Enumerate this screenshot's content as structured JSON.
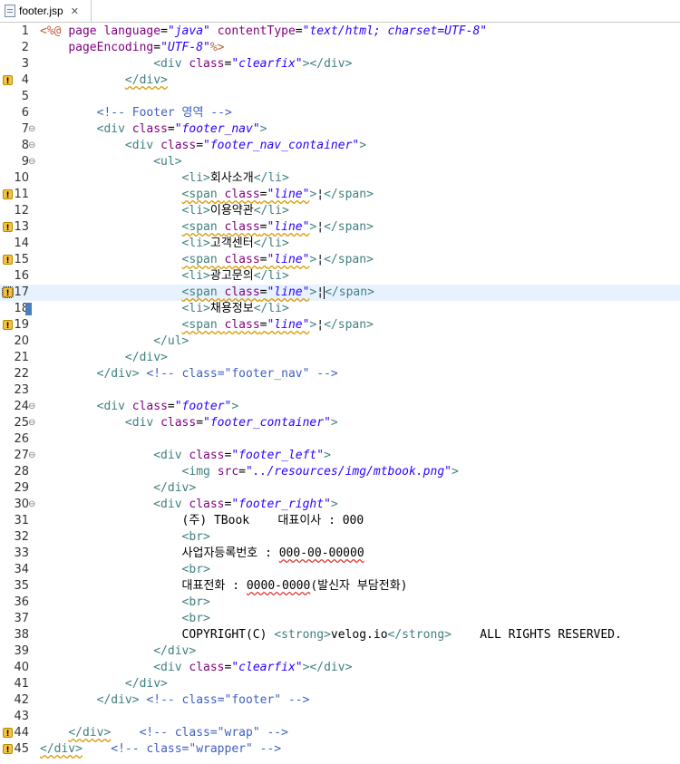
{
  "tab": {
    "filename": "footer.jsp",
    "close_glyph": "✕"
  },
  "colors": {
    "tag": "#3f7f7f",
    "attribute": "#7f007f",
    "value": "#2a00ff",
    "comment": "#3f5fbf",
    "jsp_delimiter": "#bf5f3f",
    "current_line": "#e8f2fe"
  },
  "lines": [
    {
      "n": "1",
      "warn": false,
      "fold": "",
      "tokens": [
        {
          "t": "jsp",
          "s": "<%@ "
        },
        {
          "t": "attr",
          "s": "page "
        },
        {
          "t": "attr",
          "s": "language"
        },
        {
          "t": "txt",
          "s": "="
        },
        {
          "t": "val",
          "s": "\"java\""
        },
        {
          "t": "txt",
          "s": " "
        },
        {
          "t": "attr",
          "s": "contentType"
        },
        {
          "t": "txt",
          "s": "="
        },
        {
          "t": "val",
          "s": "\"text/html; charset=UTF-8\""
        }
      ]
    },
    {
      "n": "2",
      "warn": false,
      "fold": "",
      "tokens": [
        {
          "t": "txt",
          "s": "    "
        },
        {
          "t": "attr",
          "s": "pageEncoding"
        },
        {
          "t": "txt",
          "s": "="
        },
        {
          "t": "val",
          "s": "\"UTF-8\""
        },
        {
          "t": "jsp",
          "s": "%>"
        }
      ]
    },
    {
      "n": "3",
      "warn": false,
      "fold": "",
      "tokens": [
        {
          "t": "txt",
          "s": "                "
        },
        {
          "t": "tag",
          "s": "<div "
        },
        {
          "t": "attr",
          "s": "class"
        },
        {
          "t": "txt",
          "s": "="
        },
        {
          "t": "val",
          "s": "\"clearfix\""
        },
        {
          "t": "tag",
          "s": "></div>"
        }
      ]
    },
    {
      "n": "4",
      "warn": true,
      "fold": "",
      "tokens": [
        {
          "t": "txt",
          "s": "            "
        },
        {
          "t": "tag sq",
          "s": "</div>"
        }
      ]
    },
    {
      "n": "5",
      "warn": false,
      "fold": "",
      "tokens": []
    },
    {
      "n": "6",
      "warn": false,
      "fold": "",
      "tokens": [
        {
          "t": "txt",
          "s": "        "
        },
        {
          "t": "cmt",
          "s": "<!-- Footer 영역 -->"
        }
      ]
    },
    {
      "n": "7",
      "warn": false,
      "fold": "⊖",
      "tokens": [
        {
          "t": "txt",
          "s": "        "
        },
        {
          "t": "tag",
          "s": "<div "
        },
        {
          "t": "attr",
          "s": "class"
        },
        {
          "t": "txt",
          "s": "="
        },
        {
          "t": "val",
          "s": "\"footer_nav\""
        },
        {
          "t": "tag",
          "s": ">"
        }
      ]
    },
    {
      "n": "8",
      "warn": false,
      "fold": "⊖",
      "tokens": [
        {
          "t": "txt",
          "s": "            "
        },
        {
          "t": "tag",
          "s": "<div "
        },
        {
          "t": "attr",
          "s": "class"
        },
        {
          "t": "txt",
          "s": "="
        },
        {
          "t": "val",
          "s": "\"footer_nav_container\""
        },
        {
          "t": "tag",
          "s": ">"
        }
      ]
    },
    {
      "n": "9",
      "warn": false,
      "fold": "⊖",
      "tokens": [
        {
          "t": "txt",
          "s": "                "
        },
        {
          "t": "tag",
          "s": "<ul>"
        }
      ]
    },
    {
      "n": "10",
      "warn": false,
      "fold": "",
      "tokens": [
        {
          "t": "txt",
          "s": "                    "
        },
        {
          "t": "tag",
          "s": "<li>"
        },
        {
          "t": "txt",
          "s": "회사소개"
        },
        {
          "t": "tag",
          "s": "</li>"
        }
      ]
    },
    {
      "n": "11",
      "warn": true,
      "fold": "",
      "tokens": [
        {
          "t": "txt",
          "s": "                    "
        },
        {
          "t": "tag sq",
          "s": "<span "
        },
        {
          "t": "attr sq",
          "s": "class"
        },
        {
          "t": "txt sq",
          "s": "="
        },
        {
          "t": "val sq",
          "s": "\"line\""
        },
        {
          "t": "tag",
          "s": ">"
        },
        {
          "t": "txt",
          "s": "¦"
        },
        {
          "t": "tag",
          "s": "</span>"
        }
      ]
    },
    {
      "n": "12",
      "warn": false,
      "fold": "",
      "tokens": [
        {
          "t": "txt",
          "s": "                    "
        },
        {
          "t": "tag",
          "s": "<li>"
        },
        {
          "t": "txt",
          "s": "이용약관"
        },
        {
          "t": "tag",
          "s": "</li>"
        }
      ]
    },
    {
      "n": "13",
      "warn": true,
      "fold": "",
      "tokens": [
        {
          "t": "txt",
          "s": "                    "
        },
        {
          "t": "tag sq",
          "s": "<span "
        },
        {
          "t": "attr sq",
          "s": "class"
        },
        {
          "t": "txt sq",
          "s": "="
        },
        {
          "t": "val sq",
          "s": "\"line\""
        },
        {
          "t": "tag",
          "s": ">"
        },
        {
          "t": "txt",
          "s": "¦"
        },
        {
          "t": "tag",
          "s": "</span>"
        }
      ]
    },
    {
      "n": "14",
      "warn": false,
      "fold": "",
      "tokens": [
        {
          "t": "txt",
          "s": "                    "
        },
        {
          "t": "tag",
          "s": "<li>"
        },
        {
          "t": "txt",
          "s": "고객센터"
        },
        {
          "t": "tag",
          "s": "</li>"
        }
      ]
    },
    {
      "n": "15",
      "warn": true,
      "fold": "",
      "tokens": [
        {
          "t": "txt",
          "s": "                    "
        },
        {
          "t": "tag sq",
          "s": "<span "
        },
        {
          "t": "attr sq",
          "s": "class"
        },
        {
          "t": "txt sq",
          "s": "="
        },
        {
          "t": "val sq",
          "s": "\"line\""
        },
        {
          "t": "tag",
          "s": ">"
        },
        {
          "t": "txt",
          "s": "¦"
        },
        {
          "t": "tag",
          "s": "</span>"
        }
      ]
    },
    {
      "n": "16",
      "warn": false,
      "fold": "",
      "tokens": [
        {
          "t": "txt",
          "s": "                    "
        },
        {
          "t": "tag",
          "s": "<li>"
        },
        {
          "t": "txt",
          "s": "광고문의"
        },
        {
          "t": "tag",
          "s": "</li>"
        }
      ]
    },
    {
      "n": "17",
      "warn": true,
      "fold": "",
      "current": true,
      "sel": true,
      "tokens": [
        {
          "t": "txt",
          "s": "                    "
        },
        {
          "t": "tag sq",
          "s": "<span "
        },
        {
          "t": "attr sq",
          "s": "class"
        },
        {
          "t": "txt sq",
          "s": "="
        },
        {
          "t": "val sq",
          "s": "\"line\""
        },
        {
          "t": "tag",
          "s": ">"
        },
        {
          "t": "txt",
          "s": "¦"
        },
        {
          "t": "caret",
          "s": ""
        },
        {
          "t": "tag",
          "s": "</span>"
        }
      ]
    },
    {
      "n": "18",
      "warn": false,
      "fold": "",
      "bookmark": true,
      "tokens": [
        {
          "t": "txt",
          "s": "                    "
        },
        {
          "t": "tag",
          "s": "<li>"
        },
        {
          "t": "txt",
          "s": "채용정보"
        },
        {
          "t": "tag",
          "s": "</li>"
        }
      ]
    },
    {
      "n": "19",
      "warn": true,
      "fold": "",
      "tokens": [
        {
          "t": "txt",
          "s": "                    "
        },
        {
          "t": "tag sq",
          "s": "<span "
        },
        {
          "t": "attr sq",
          "s": "class"
        },
        {
          "t": "txt sq",
          "s": "="
        },
        {
          "t": "val sq",
          "s": "\"line\""
        },
        {
          "t": "tag",
          "s": ">"
        },
        {
          "t": "txt",
          "s": "¦"
        },
        {
          "t": "tag",
          "s": "</span>"
        }
      ]
    },
    {
      "n": "20",
      "warn": false,
      "fold": "",
      "tokens": [
        {
          "t": "txt",
          "s": "                "
        },
        {
          "t": "tag",
          "s": "</ul>"
        }
      ]
    },
    {
      "n": "21",
      "warn": false,
      "fold": "",
      "tokens": [
        {
          "t": "txt",
          "s": "            "
        },
        {
          "t": "tag",
          "s": "</div>"
        }
      ]
    },
    {
      "n": "22",
      "warn": false,
      "fold": "",
      "tokens": [
        {
          "t": "txt",
          "s": "        "
        },
        {
          "t": "tag",
          "s": "</div>"
        },
        {
          "t": "txt",
          "s": " "
        },
        {
          "t": "cmt",
          "s": "<!-- class=\"footer_nav\" -->"
        }
      ]
    },
    {
      "n": "23",
      "warn": false,
      "fold": "",
      "tokens": []
    },
    {
      "n": "24",
      "warn": false,
      "fold": "⊖",
      "tokens": [
        {
          "t": "txt",
          "s": "        "
        },
        {
          "t": "tag",
          "s": "<div "
        },
        {
          "t": "attr",
          "s": "class"
        },
        {
          "t": "txt",
          "s": "="
        },
        {
          "t": "val",
          "s": "\"footer\""
        },
        {
          "t": "tag",
          "s": ">"
        }
      ]
    },
    {
      "n": "25",
      "warn": false,
      "fold": "⊖",
      "tokens": [
        {
          "t": "txt",
          "s": "            "
        },
        {
          "t": "tag",
          "s": "<div "
        },
        {
          "t": "attr",
          "s": "class"
        },
        {
          "t": "txt",
          "s": "="
        },
        {
          "t": "val",
          "s": "\"footer_container\""
        },
        {
          "t": "tag",
          "s": ">"
        }
      ]
    },
    {
      "n": "26",
      "warn": false,
      "fold": "",
      "tokens": []
    },
    {
      "n": "27",
      "warn": false,
      "fold": "⊖",
      "tokens": [
        {
          "t": "txt",
          "s": "                "
        },
        {
          "t": "tag",
          "s": "<div "
        },
        {
          "t": "attr",
          "s": "class"
        },
        {
          "t": "txt",
          "s": "="
        },
        {
          "t": "val",
          "s": "\"footer_left\""
        },
        {
          "t": "tag",
          "s": ">"
        }
      ]
    },
    {
      "n": "28",
      "warn": false,
      "fold": "",
      "tokens": [
        {
          "t": "txt",
          "s": "                    "
        },
        {
          "t": "tag",
          "s": "<img "
        },
        {
          "t": "attr",
          "s": "src"
        },
        {
          "t": "txt",
          "s": "="
        },
        {
          "t": "val",
          "s": "\"../resources/img/mtbook.png\""
        },
        {
          "t": "tag",
          "s": ">"
        }
      ]
    },
    {
      "n": "29",
      "warn": false,
      "fold": "",
      "tokens": [
        {
          "t": "txt",
          "s": "                "
        },
        {
          "t": "tag",
          "s": "</div>"
        }
      ]
    },
    {
      "n": "30",
      "warn": false,
      "fold": "⊖",
      "tokens": [
        {
          "t": "txt",
          "s": "                "
        },
        {
          "t": "tag",
          "s": "<div "
        },
        {
          "t": "attr",
          "s": "class"
        },
        {
          "t": "txt",
          "s": "="
        },
        {
          "t": "val",
          "s": "\"footer_right\""
        },
        {
          "t": "tag",
          "s": ">"
        }
      ]
    },
    {
      "n": "31",
      "warn": false,
      "fold": "",
      "tokens": [
        {
          "t": "txt",
          "s": "                    (주) TBook    대표이사 : 000"
        }
      ]
    },
    {
      "n": "32",
      "warn": false,
      "fold": "",
      "tokens": [
        {
          "t": "txt",
          "s": "                    "
        },
        {
          "t": "tag",
          "s": "<br>"
        }
      ]
    },
    {
      "n": "33",
      "warn": false,
      "fold": "",
      "tokens": [
        {
          "t": "txt",
          "s": "                    사업자등록번호 : "
        },
        {
          "t": "txt er",
          "s": "000-00-00000"
        }
      ]
    },
    {
      "n": "34",
      "warn": false,
      "fold": "",
      "tokens": [
        {
          "t": "txt",
          "s": "                    "
        },
        {
          "t": "tag",
          "s": "<br>"
        }
      ]
    },
    {
      "n": "35",
      "warn": false,
      "fold": "",
      "tokens": [
        {
          "t": "txt",
          "s": "                    대표전화 : "
        },
        {
          "t": "txt er",
          "s": "0000-0000"
        },
        {
          "t": "txt",
          "s": "(발신자 부담전화)"
        }
      ]
    },
    {
      "n": "36",
      "warn": false,
      "fold": "",
      "tokens": [
        {
          "t": "txt",
          "s": "                    "
        },
        {
          "t": "tag",
          "s": "<br>"
        }
      ]
    },
    {
      "n": "37",
      "warn": false,
      "fold": "",
      "tokens": [
        {
          "t": "txt",
          "s": "                    "
        },
        {
          "t": "tag",
          "s": "<br>"
        }
      ]
    },
    {
      "n": "38",
      "warn": false,
      "fold": "",
      "tokens": [
        {
          "t": "txt",
          "s": "                    COPYRIGHT(C) "
        },
        {
          "t": "tag",
          "s": "<strong>"
        },
        {
          "t": "txt",
          "s": "velog.io"
        },
        {
          "t": "tag",
          "s": "</strong>"
        },
        {
          "t": "txt",
          "s": "    ALL RIGHTS RESERVED."
        }
      ]
    },
    {
      "n": "39",
      "warn": false,
      "fold": "",
      "tokens": [
        {
          "t": "txt",
          "s": "                "
        },
        {
          "t": "tag",
          "s": "</div>"
        }
      ]
    },
    {
      "n": "40",
      "warn": false,
      "fold": "",
      "tokens": [
        {
          "t": "txt",
          "s": "                "
        },
        {
          "t": "tag",
          "s": "<div "
        },
        {
          "t": "attr",
          "s": "class"
        },
        {
          "t": "txt",
          "s": "="
        },
        {
          "t": "val",
          "s": "\"clearfix\""
        },
        {
          "t": "tag",
          "s": "></div>"
        }
      ]
    },
    {
      "n": "41",
      "warn": false,
      "fold": "",
      "tokens": [
        {
          "t": "txt",
          "s": "            "
        },
        {
          "t": "tag",
          "s": "</div>"
        }
      ]
    },
    {
      "n": "42",
      "warn": false,
      "fold": "",
      "tokens": [
        {
          "t": "txt",
          "s": "        "
        },
        {
          "t": "tag",
          "s": "</div>"
        },
        {
          "t": "txt",
          "s": " "
        },
        {
          "t": "cmt",
          "s": "<!-- class=\"footer\" -->"
        }
      ]
    },
    {
      "n": "43",
      "warn": false,
      "fold": "",
      "tokens": []
    },
    {
      "n": "44",
      "warn": true,
      "fold": "",
      "tokens": [
        {
          "t": "txt",
          "s": "    "
        },
        {
          "t": "tag sq",
          "s": "</div>"
        },
        {
          "t": "txt",
          "s": "    "
        },
        {
          "t": "cmt",
          "s": "<!-- class=\"wrap\" -->"
        }
      ]
    },
    {
      "n": "45",
      "warn": true,
      "fold": "",
      "tokens": [
        {
          "t": "tag sq",
          "s": "</div>"
        },
        {
          "t": "txt",
          "s": "    "
        },
        {
          "t": "cmt",
          "s": "<!-- class=\"wrapper\" -->"
        }
      ]
    }
  ]
}
